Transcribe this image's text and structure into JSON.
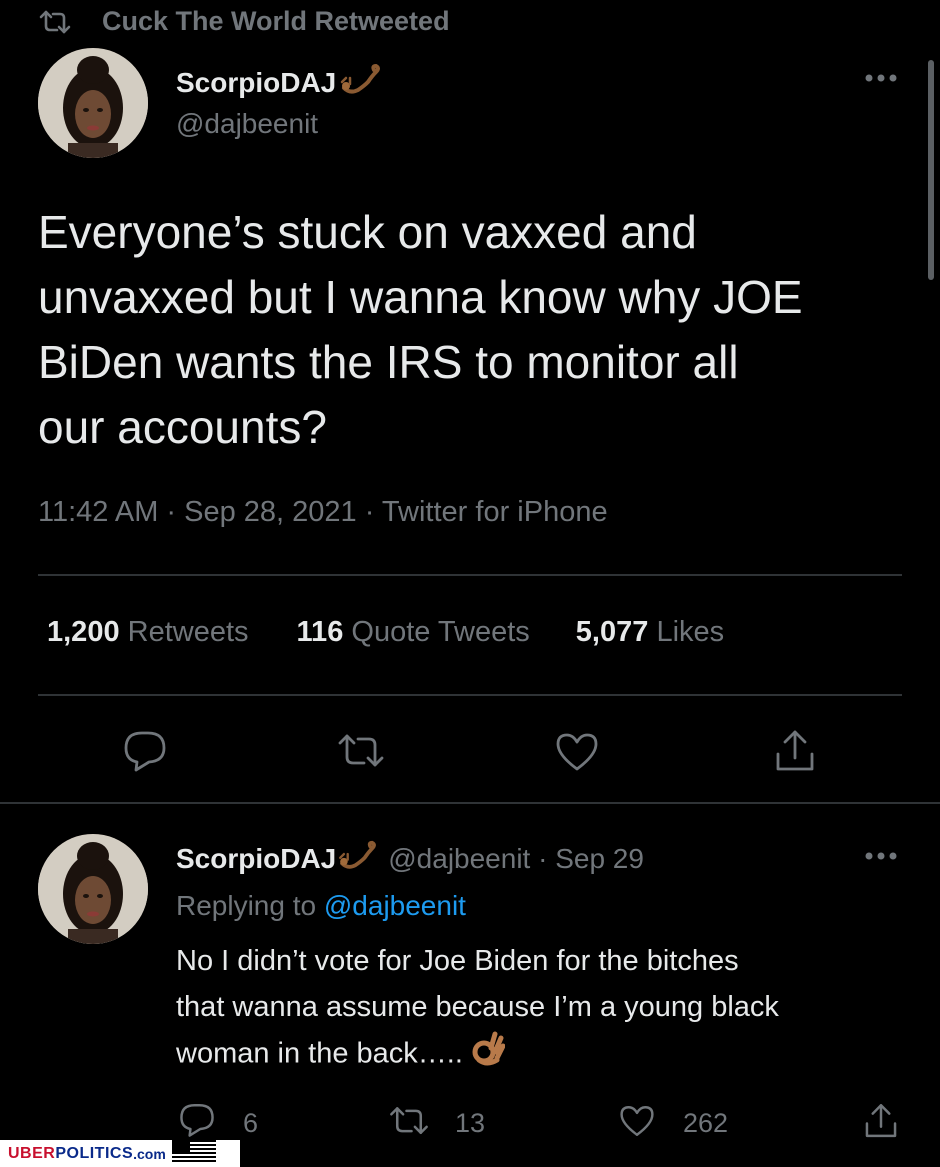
{
  "retweet_banner": {
    "text": "Cuck The World Retweeted"
  },
  "tweet": {
    "display_name": "ScorpioDAJ",
    "handle": "@dajbeenit",
    "text_lines": [
      "Everyone’s stuck on vaxxed and",
      "unvaxxed but I wanna know why JOE",
      "BiDen wants the IRS to monitor all",
      "our accounts?"
    ],
    "meta": "11:42 AM · Sep 28, 2021 · Twitter for iPhone",
    "stats": {
      "retweets_count": "1,200",
      "retweets_label": "Retweets",
      "quotes_count": "116",
      "quotes_label": "Quote Tweets",
      "likes_count": "5,077",
      "likes_label": "Likes"
    }
  },
  "reply": {
    "display_name": "ScorpioDAJ",
    "handle_date": "@dajbeenit · Sep 29",
    "replying_prefix": "Replying to",
    "replying_handle": "@dajbeenit",
    "text_lines": [
      "No I didn’t vote for Joe Biden for the bitches",
      "that wanna assume because I’m a young black",
      "woman in the back….."
    ],
    "reply_count": "6",
    "retweet_count": "13",
    "like_count": "262"
  },
  "icons": {
    "name_emoji": "scorpion-icon",
    "reply_end_emoji": "ok-hand-icon",
    "more": "more-icon",
    "reply": "reply-icon",
    "retweet": "retweet-icon",
    "like": "heart-icon",
    "share": "share-icon"
  },
  "colors": {
    "background": "#000000",
    "text": "#e7e9ea",
    "muted": "#71767b",
    "link": "#1d9bf0",
    "divider": "#2f3336"
  },
  "watermark": {
    "brand_prefix": "UBER",
    "brand_main": "POLITICS",
    "brand_suffix": ".com"
  }
}
